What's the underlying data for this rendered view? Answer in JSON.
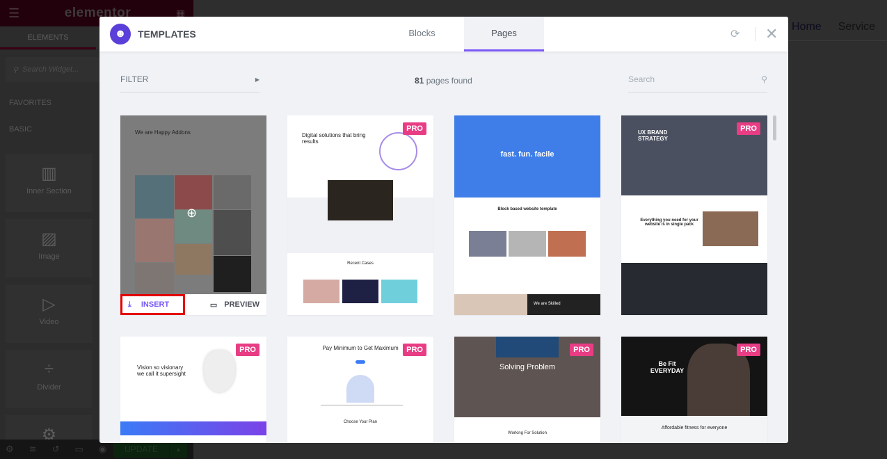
{
  "editor": {
    "logo": "elementor",
    "tab": "ELEMENTS",
    "search_placeholder": "Search Widget...",
    "favorites": "FAVORITES",
    "basic": "BASIC",
    "widgets": [
      {
        "label": "Inner Section",
        "icon": "columns-icon"
      },
      {
        "label": "Image",
        "icon": "image-icon"
      },
      {
        "label": "Video",
        "icon": "video-icon"
      },
      {
        "label": "Divider",
        "icon": "divider-icon"
      }
    ],
    "update": "UPDATE"
  },
  "page_nav": [
    "Home",
    "Service"
  ],
  "modal": {
    "title": "TEMPLATES",
    "tabs": [
      {
        "label": "Blocks",
        "active": false
      },
      {
        "label": "Pages",
        "active": true
      }
    ],
    "filter": "FILTER",
    "count": "81",
    "count_suffix": "pages found",
    "search_placeholder": "Search",
    "insert": "INSERT",
    "preview": "PREVIEW",
    "pro": "PRO",
    "accent": "#7a5af8",
    "pro_color": "#e83d84",
    "cards": [
      {
        "headline": "We are Happy Addons",
        "pro": false
      },
      {
        "headline": "Digital solutions that bring results",
        "sub": "Recent Cases",
        "pro": true
      },
      {
        "headline": "fast. fun. facile",
        "sub": "Block based website template",
        "sub2": "We are Skilled",
        "pro": false
      },
      {
        "headline": "UX BRAND STRATEGY",
        "sub": "Everything you need for your website is in single pack",
        "pro": true
      },
      {
        "headline": "Vision so visionary we call it supersight",
        "pro": true
      },
      {
        "headline": "Pay Minimum to Get Maximum",
        "sub": "Choose Your Plan",
        "pro": true
      },
      {
        "headline": "Solving Problem",
        "sub": "Working For Solution",
        "pro": true
      },
      {
        "headline": "Be Fit EVERYDAY",
        "sub": "Affordable fitness for everyone",
        "pro": true
      }
    ]
  }
}
